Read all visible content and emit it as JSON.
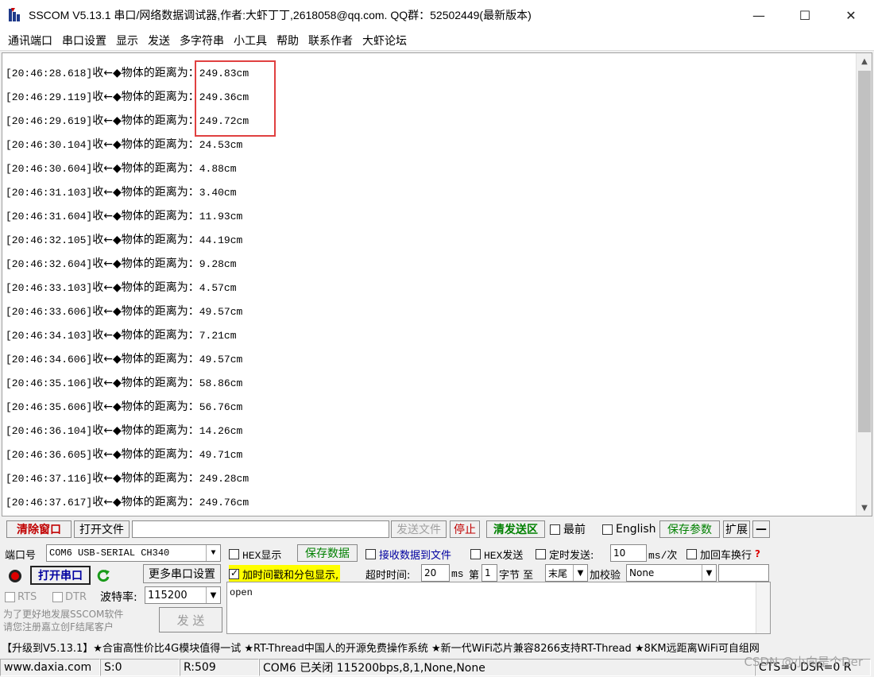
{
  "window": {
    "title": "SSCOM V5.13.1 串口/网络数据调试器,作者:大虾丁丁,2618058@qq.com. QQ群：52502449(最新版本)",
    "minimize": "—",
    "maximize": "☐",
    "close": "✕"
  },
  "menu": [
    "通讯端口",
    "串口设置",
    "显示",
    "发送",
    "多字符串",
    "小工具",
    "帮助",
    "联系作者",
    "大虾论坛"
  ],
  "log": {
    "prefix": "收←◆物体的距离为：",
    "lines": [
      {
        "ts": "[20:46:28.618]",
        "value": "249.83cm"
      },
      {
        "ts": "[20:46:29.119]",
        "value": "249.36cm"
      },
      {
        "ts": "[20:46:29.619]",
        "value": "249.72cm"
      },
      {
        "ts": "[20:46:30.104]",
        "value": "24.53cm"
      },
      {
        "ts": "[20:46:30.604]",
        "value": "4.88cm"
      },
      {
        "ts": "[20:46:31.103]",
        "value": "3.40cm"
      },
      {
        "ts": "[20:46:31.604]",
        "value": "11.93cm"
      },
      {
        "ts": "[20:46:32.105]",
        "value": "44.19cm"
      },
      {
        "ts": "[20:46:32.604]",
        "value": "9.28cm"
      },
      {
        "ts": "[20:46:33.103]",
        "value": "4.57cm"
      },
      {
        "ts": "[20:46:33.606]",
        "value": "49.57cm"
      },
      {
        "ts": "[20:46:34.103]",
        "value": "7.21cm"
      },
      {
        "ts": "[20:46:34.606]",
        "value": "49.57cm"
      },
      {
        "ts": "[20:46:35.106]",
        "value": "58.86cm"
      },
      {
        "ts": "[20:46:35.606]",
        "value": "56.76cm"
      },
      {
        "ts": "[20:46:36.104]",
        "value": "14.26cm"
      },
      {
        "ts": "[20:46:36.605]",
        "value": "49.71cm"
      },
      {
        "ts": "[20:46:37.116]",
        "value": "249.28cm"
      },
      {
        "ts": "[20:46:37.617]",
        "value": "249.76cm"
      }
    ]
  },
  "toolbar": {
    "clear_window": "清除窗口",
    "open_file": "打开文件",
    "send_file": "发送文件",
    "stop": "停止",
    "clear_send": "清发送区",
    "topmost": "最前",
    "english": "English",
    "save_params": "保存参数",
    "expand": "扩展",
    "collapse": "—"
  },
  "panel": {
    "port_label": "端口号",
    "port_value": "COM6 USB-SERIAL CH340",
    "hex_display": "HEX显示",
    "save_data": "保存数据",
    "recv_to_file": "接收数据到文件",
    "hex_send": "HEX发送",
    "timed_send": "定时发送:",
    "interval_value": "10",
    "interval_unit": "ms/次",
    "add_crlf": "加回车换行",
    "open_port": "打开串口",
    "more_settings": "更多串口设置",
    "timestamp_option": "加时间戳和分包显示,",
    "timeout_label": "超时时间:",
    "timeout_value": "20",
    "timeout_unit": "ms",
    "nth_label": "第",
    "nth_value": "1",
    "byte_label": "字节 至",
    "end_value": "末尾",
    "checksum_label": "加校验",
    "checksum_value": "None",
    "rts": "RTS",
    "dtr": "DTR",
    "baud_label": "波特率:",
    "baud_value": "115200",
    "send_text": "open",
    "promo": "为了更好地发展SSCOM软件\n请您注册嘉立创F结尾客户",
    "send_button": "发 送"
  },
  "banner": "【升级到V5.13.1】★合宙高性价比4G模块值得一试 ★RT-Thread中国人的开源免费操作系统 ★新一代WiFi芯片兼容8266支持RT-Thread ★8KM远距离WiFi可自组网",
  "status": {
    "site": "www.daxia.com",
    "sent": "S:0",
    "received": "R:509",
    "port_state": "COM6 已关闭  115200bps,8,1,None,None",
    "lines": "CTS=0 DSR=0 R",
    "watermark": "CSDN @小向是个Der"
  }
}
